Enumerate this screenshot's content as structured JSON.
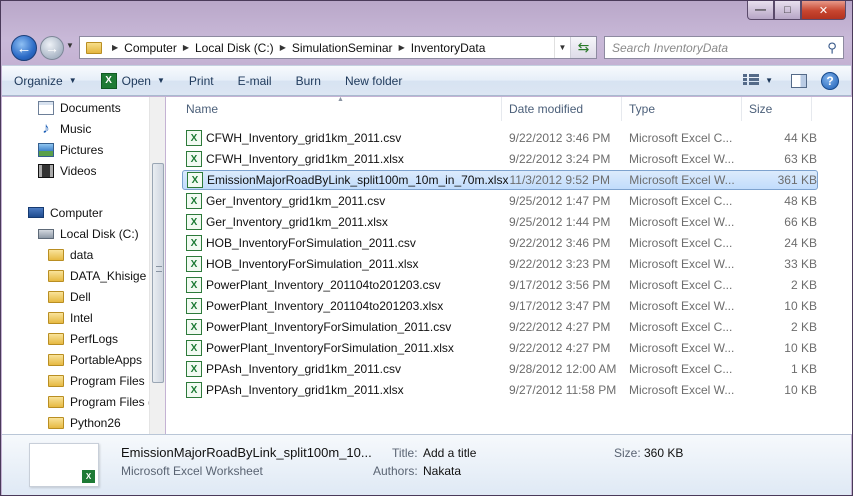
{
  "window": {
    "minimize": "—",
    "maximize": "□",
    "close": "✕"
  },
  "address": {
    "crumbs": [
      "Computer",
      "Local Disk (C:)",
      "SimulationSeminar",
      "InventoryData"
    ]
  },
  "search": {
    "placeholder": "Search InventoryData"
  },
  "toolbar": {
    "organize": "Organize",
    "open": "Open",
    "print": "Print",
    "email": "E-mail",
    "burn": "Burn",
    "new_folder": "New folder"
  },
  "navpane": {
    "libraries": [
      "Documents",
      "Music",
      "Pictures",
      "Videos"
    ],
    "computer": "Computer",
    "disk": "Local Disk (C:)",
    "folders": [
      "data",
      "DATA_Khisige",
      "Dell",
      "Intel",
      "PerfLogs",
      "PortableApps",
      "Program Files",
      "Program Files (",
      "Python26"
    ]
  },
  "columns": {
    "name": "Name",
    "date": "Date modified",
    "type": "Type",
    "size": "Size"
  },
  "files": [
    {
      "name": "CFWH_Inventory_grid1km_2011.csv",
      "date": "9/22/2012 3:46 PM",
      "type": "Microsoft Excel C...",
      "size": "44 KB"
    },
    {
      "name": "CFWH_Inventory_grid1km_2011.xlsx",
      "date": "9/22/2012 3:24 PM",
      "type": "Microsoft Excel W...",
      "size": "63 KB"
    },
    {
      "name": "EmissionMajorRoadByLink_split100m_10m_in_70m.xlsx",
      "date": "11/3/2012 9:52 PM",
      "type": "Microsoft Excel W...",
      "size": "361 KB"
    },
    {
      "name": "Ger_Inventory_grid1km_2011.csv",
      "date": "9/25/2012 1:47 PM",
      "type": "Microsoft Excel C...",
      "size": "48 KB"
    },
    {
      "name": "Ger_Inventory_grid1km_2011.xlsx",
      "date": "9/25/2012 1:44 PM",
      "type": "Microsoft Excel W...",
      "size": "66 KB"
    },
    {
      "name": "HOB_InventoryForSimulation_2011.csv",
      "date": "9/22/2012 3:46 PM",
      "type": "Microsoft Excel C...",
      "size": "24 KB"
    },
    {
      "name": "HOB_InventoryForSimulation_2011.xlsx",
      "date": "9/22/2012 3:23 PM",
      "type": "Microsoft Excel W...",
      "size": "33 KB"
    },
    {
      "name": "PowerPlant_Inventory_201104to201203.csv",
      "date": "9/17/2012 3:56 PM",
      "type": "Microsoft Excel C...",
      "size": "2 KB"
    },
    {
      "name": "PowerPlant_Inventory_201104to201203.xlsx",
      "date": "9/17/2012 3:47 PM",
      "type": "Microsoft Excel W...",
      "size": "10 KB"
    },
    {
      "name": "PowerPlant_InventoryForSimulation_2011.csv",
      "date": "9/22/2012 4:27 PM",
      "type": "Microsoft Excel C...",
      "size": "2 KB"
    },
    {
      "name": "PowerPlant_InventoryForSimulation_2011.xlsx",
      "date": "9/22/2012 4:27 PM",
      "type": "Microsoft Excel W...",
      "size": "10 KB"
    },
    {
      "name": "PPAsh_Inventory_grid1km_2011.csv",
      "date": "9/28/2012 12:00 AM",
      "type": "Microsoft Excel C...",
      "size": "1 KB"
    },
    {
      "name": "PPAsh_Inventory_grid1km_2011.xlsx",
      "date": "9/27/2012 11:58 PM",
      "type": "Microsoft Excel W...",
      "size": "10 KB"
    }
  ],
  "details": {
    "name": "EmissionMajorRoadByLink_split100m_10...",
    "type": "Microsoft Excel Worksheet",
    "title_label": "Title:",
    "title_value": "Add a title",
    "authors_label": "Authors:",
    "authors_value": "Nakata",
    "size_label": "Size:",
    "size_value": "360 KB"
  }
}
